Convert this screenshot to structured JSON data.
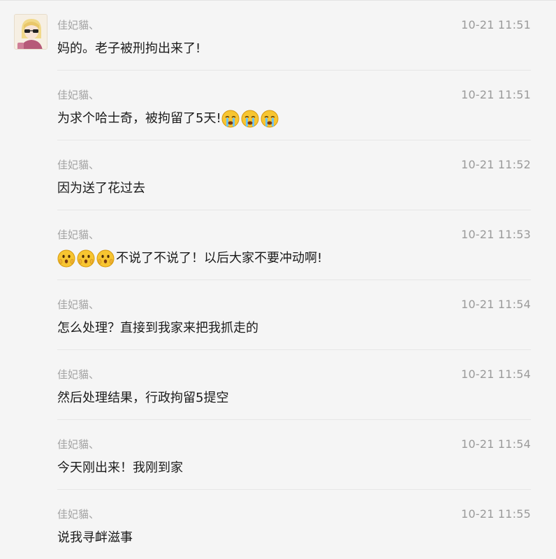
{
  "messages": [
    {
      "sender": "佳妃貓、",
      "time": "10-21 11:51",
      "segments": [
        {
          "type": "text",
          "text": "妈的。老子被刑拘出来了!"
        }
      ],
      "avatar": true
    },
    {
      "sender": "佳妃貓、",
      "time": "10-21 11:51",
      "segments": [
        {
          "type": "text",
          "text": "为求个哈士奇，被拘留了5天!"
        },
        {
          "type": "emoji",
          "icon": "crying-face-emoji"
        },
        {
          "type": "emoji",
          "icon": "crying-face-emoji"
        },
        {
          "type": "emoji",
          "icon": "crying-face-emoji"
        }
      ]
    },
    {
      "sender": "佳妃貓、",
      "time": "10-21 11:52",
      "segments": [
        {
          "type": "text",
          "text": "因为送了花过去"
        }
      ]
    },
    {
      "sender": "佳妃貓、",
      "time": "10-21 11:53",
      "segments": [
        {
          "type": "emoji",
          "icon": "shocked-face-emoji"
        },
        {
          "type": "emoji",
          "icon": "shocked-face-emoji"
        },
        {
          "type": "emoji",
          "icon": "shocked-face-emoji"
        },
        {
          "type": "text",
          "text": "不说了不说了！以后大家不要冲动啊!"
        }
      ]
    },
    {
      "sender": "佳妃貓、",
      "time": "10-21 11:54",
      "segments": [
        {
          "type": "text",
          "text": "怎么处理？直接到我家来把我抓走的"
        }
      ]
    },
    {
      "sender": "佳妃貓、",
      "time": "10-21 11:54",
      "segments": [
        {
          "type": "text",
          "text": "然后处理结果，行政拘留5提空"
        }
      ]
    },
    {
      "sender": "佳妃貓、",
      "time": "10-21 11:54",
      "segments": [
        {
          "type": "text",
          "text": "今天刚出来！我刚到家"
        }
      ]
    },
    {
      "sender": "佳妃貓、",
      "time": "10-21 11:55",
      "segments": [
        {
          "type": "text",
          "text": "说我寻衅滋事"
        }
      ]
    }
  ],
  "colors": {
    "background": "#f5f5f5",
    "sender": "#a3a3a3",
    "time": "#9a9a9a",
    "text": "#1b1b1b",
    "divider": "#e6e6e6",
    "emoji_face": "#f7c531"
  }
}
